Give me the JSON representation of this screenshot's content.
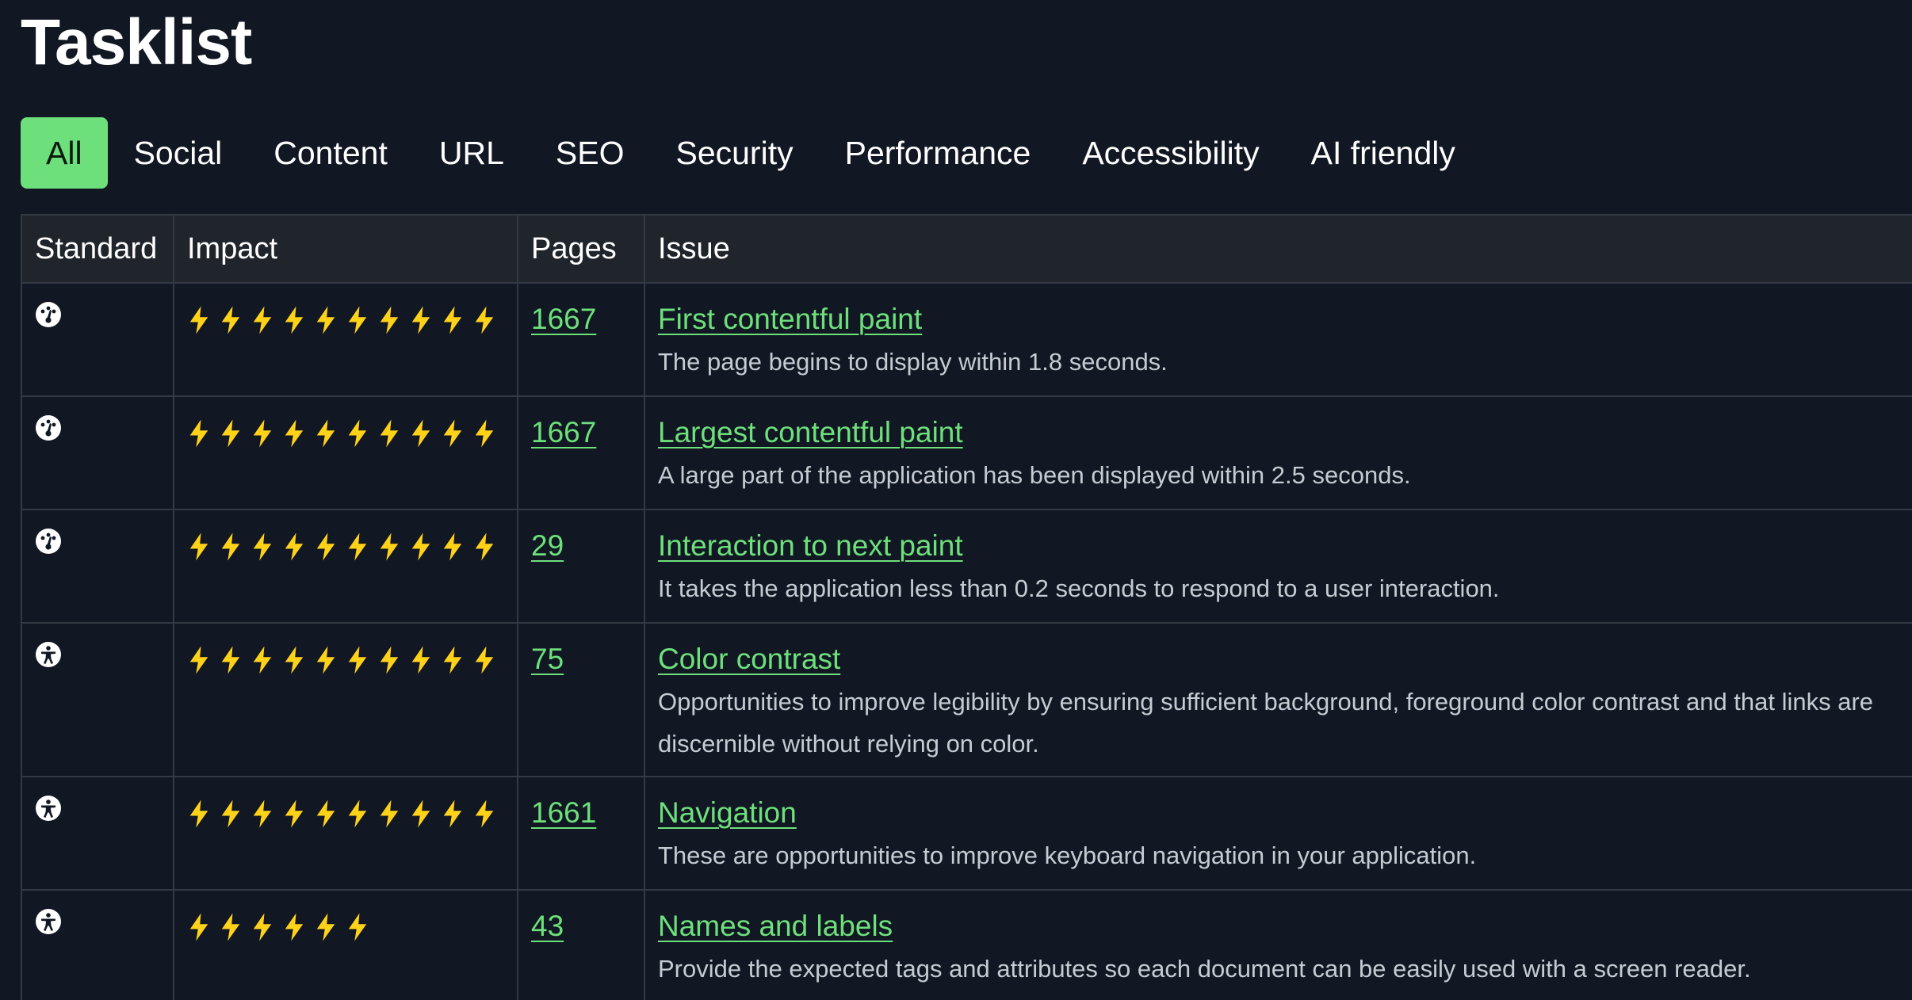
{
  "page": {
    "title": "Tasklist"
  },
  "tabs": [
    {
      "label": "All",
      "active": true
    },
    {
      "label": "Social",
      "active": false
    },
    {
      "label": "Content",
      "active": false
    },
    {
      "label": "URL",
      "active": false
    },
    {
      "label": "SEO",
      "active": false
    },
    {
      "label": "Security",
      "active": false
    },
    {
      "label": "Performance",
      "active": false
    },
    {
      "label": "Accessibility",
      "active": false
    },
    {
      "label": "AI friendly",
      "active": false
    }
  ],
  "table": {
    "headers": {
      "standard": "Standard",
      "impact": "Impact",
      "pages": "Pages",
      "issue": "Issue"
    },
    "rows": [
      {
        "standard_icon": "speedometer-icon",
        "impact": 10,
        "pages": "1667",
        "title": "First contentful paint",
        "description": "The page begins to display within 1.8 seconds."
      },
      {
        "standard_icon": "speedometer-icon",
        "impact": 10,
        "pages": "1667",
        "title": "Largest contentful paint",
        "description": "A large part of the application has been displayed within 2.5 seconds."
      },
      {
        "standard_icon": "speedometer-icon",
        "impact": 10,
        "pages": "29",
        "title": "Interaction to next paint",
        "description": "It takes the application less than 0.2 seconds to respond to a user interaction."
      },
      {
        "standard_icon": "accessibility-icon",
        "impact": 10,
        "pages": "75",
        "title": "Color contrast",
        "description": "Opportunities to improve legibility by ensuring sufficient background, foreground color contrast and that links are discernible without relying on color."
      },
      {
        "standard_icon": "accessibility-icon",
        "impact": 10,
        "pages": "1661",
        "title": "Navigation",
        "description": "These are opportunities to improve keyboard navigation in your application."
      },
      {
        "standard_icon": "accessibility-icon",
        "impact": 6,
        "pages": "43",
        "title": "Names and labels",
        "description": "Provide the expected tags and attributes so each document can be easily used with a screen reader."
      }
    ]
  },
  "colors": {
    "background": "#111723",
    "header_bg": "#20252c",
    "accent": "#6ee07b",
    "bolt": "#ffd21a",
    "border": "#343a44",
    "muted_text": "#c6cbd2"
  }
}
